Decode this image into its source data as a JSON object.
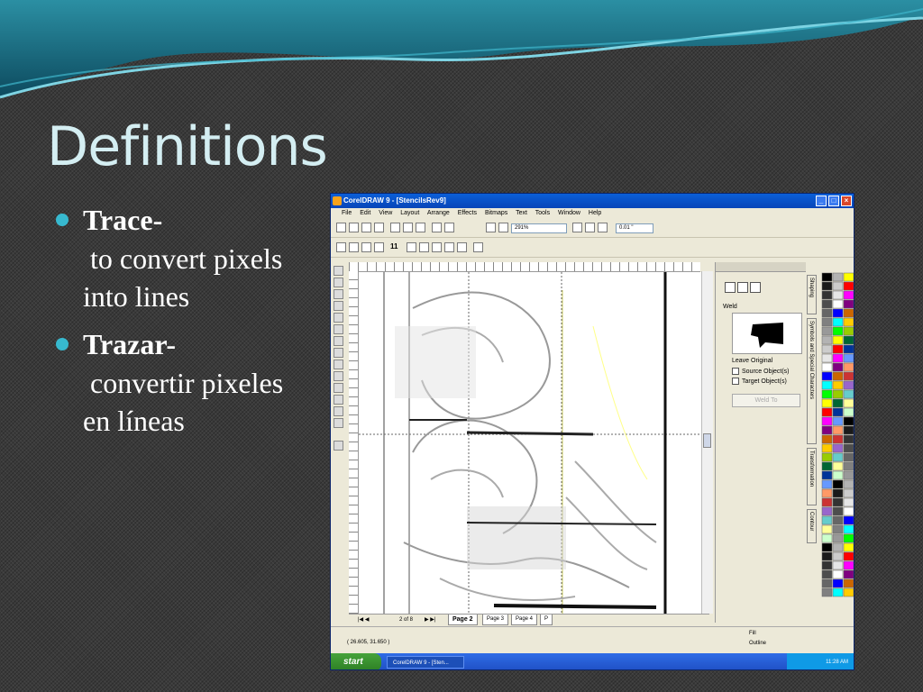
{
  "slide": {
    "title": "Definitions",
    "bullets": [
      {
        "term": "Trace",
        "dash": "-",
        "definition_line1": "to convert pixels",
        "definition_line2": "into lines"
      },
      {
        "term": "Trazar",
        "dash": "-",
        "definition_line1": "convertir pixeles",
        "definition_line2": "en líneas"
      }
    ],
    "colors": {
      "accent": "#37b9cf",
      "title": "#d4eef2",
      "text": "#ffffff",
      "background": "#3a3a3a"
    }
  },
  "app": {
    "window_title": "CorelDRAW 9 - [StencilsRev9]",
    "menu": [
      "File",
      "Edit",
      "View",
      "Layout",
      "Arrange",
      "Effects",
      "Bitmaps",
      "Text",
      "Tools",
      "Window",
      "Help"
    ],
    "zoom_level": "291%",
    "nudge": "0.01 \"",
    "zoom_toolbar_value": "11",
    "ruler_units": "inches",
    "docker": {
      "section_label": "Weld",
      "leave_original_label": "Leave Original",
      "source_objects_label": "Source Object(s)",
      "target_objects_label": "Target Object(s)",
      "weld_button_label": "Weld To"
    },
    "docker_tabs": [
      "Shaping",
      "Symbols and Special Characters",
      "Transformation",
      "Contour"
    ],
    "page_nav": {
      "page_count_text": "2 of 8",
      "tabs": [
        "Page 2",
        "Page 3",
        "Page 4",
        "P"
      ]
    },
    "status": {
      "coordinates": "( 26.605, 31.650 )",
      "fill_label": "Fill",
      "outline_label": "Outline"
    },
    "taskbar": {
      "start_label": "start",
      "task_item": "CorelDRAW 9 - [Sten...",
      "clock": "11:28 AM"
    },
    "palette_colors": [
      "#000000",
      "#1a1a1a",
      "#333333",
      "#4d4d4d",
      "#666666",
      "#808080",
      "#999999",
      "#b3b3b3",
      "#cccccc",
      "#e6e6e6",
      "#ffffff",
      "#0000ff",
      "#00ffff",
      "#00ff00",
      "#ffff00",
      "#ff0000",
      "#ff00ff",
      "#800080",
      "#cc6600",
      "#ffcc00",
      "#99cc00",
      "#006633",
      "#003399",
      "#6699ff",
      "#ff9966",
      "#cc3333",
      "#9966cc",
      "#66cccc",
      "#ffff99",
      "#ccffcc"
    ]
  }
}
